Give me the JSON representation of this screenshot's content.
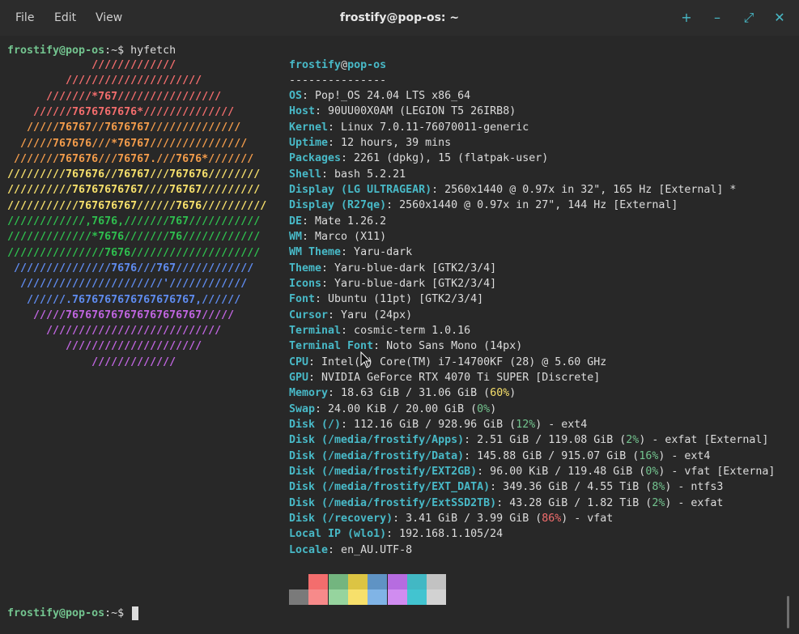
{
  "menu": {
    "file": "File",
    "edit": "Edit",
    "view": "View"
  },
  "window_title": "frostify@pop-os: ~",
  "window_buttons": {
    "new_tab": "+",
    "minimize": "–",
    "maximize": "⤢",
    "close": "✕"
  },
  "prompt": {
    "user": "frostify@pop-os",
    "sep": ":",
    "path": "~",
    "dollar": "$ ",
    "command": "hyfetch"
  },
  "art": [
    {
      "text": "             /////////////",
      "color": "#f36d6d"
    },
    {
      "text": "         /////////////////////",
      "color": "#f36d6d"
    },
    {
      "text": "      ///////*767////////////////",
      "color": "#f36d6d"
    },
    {
      "text": "    //////7676767676*//////////////",
      "color": "#f36d6d"
    },
    {
      "text": "   /////76767//7676767//////////////",
      "color": "#f39c4b"
    },
    {
      "text": "  /////767676///*76767///////////////",
      "color": "#f39c4b"
    },
    {
      "text": " ///////767676///76767.///7676*///////",
      "color": "#f39c4b"
    },
    {
      "text": "/////////767676//76767///767676////////",
      "color": "#f7e06b"
    },
    {
      "text": "//////////76767676767////76767/////////",
      "color": "#f7e06b"
    },
    {
      "text": "///////////767676767//////7676//////////",
      "color": "#f7e06b"
    },
    {
      "text": "////////////,7676,///////767///////////",
      "color": "#2fbf4f"
    },
    {
      "text": "/////////////*7676///////76////////////",
      "color": "#2fbf4f"
    },
    {
      "text": "///////////////7676////////////////////",
      "color": "#2fbf4f"
    },
    {
      "text": " ///////////////7676///767////////////",
      "color": "#5f8cf0"
    },
    {
      "text": "  //////////////////////'////////////",
      "color": "#5f8cf0"
    },
    {
      "text": "   //////.7676767676767676767,//////",
      "color": "#5f8cf0"
    },
    {
      "text": "    /////767676767676767676767/////",
      "color": "#c065e0"
    },
    {
      "text": "      ///////////////////////////",
      "color": "#c065e0"
    },
    {
      "text": "         /////////////////////",
      "color": "#c065e0"
    },
    {
      "text": "             /////////////",
      "color": "#c065e0"
    }
  ],
  "info_header": {
    "user": "frostify",
    "at": "@",
    "host": "pop-os",
    "rule": "---------------"
  },
  "info": [
    {
      "key": "OS",
      "val": ": Pop!_OS 24.04 LTS x86_64"
    },
    {
      "key": "Host",
      "val": ": 90UU00X0AM (LEGION T5 26IRB8)"
    },
    {
      "key": "Kernel",
      "val": ": Linux 7.0.11-76070011-generic"
    },
    {
      "key": "Uptime",
      "val": ": 12 hours, 39 mins"
    },
    {
      "key": "Packages",
      "val": ": 2261 (dpkg), 15 (flatpak-user)"
    },
    {
      "key": "Shell",
      "val": ": bash 5.2.21"
    },
    {
      "key": "Display (LG ULTRAGEAR)",
      "val": ": 2560x1440 @ 0.97x in 32\", 165 Hz [External] *"
    },
    {
      "key": "Display (R27qe)",
      "val": ": 2560x1440 @ 0.97x in 27\", 144 Hz [External]"
    },
    {
      "key": "DE",
      "val": ": Mate 1.26.2"
    },
    {
      "key": "WM",
      "val": ": Marco (X11)"
    },
    {
      "key": "WM Theme",
      "val": ": Yaru-dark"
    },
    {
      "key": "Theme",
      "val": ": Yaru-blue-dark [GTK2/3/4]"
    },
    {
      "key": "Icons",
      "val": ": Yaru-blue-dark [GTK2/3/4]"
    },
    {
      "key": "Font",
      "val": ": Ubuntu (11pt) [GTK2/3/4]"
    },
    {
      "key": "Cursor",
      "val": ": Yaru (24px)"
    },
    {
      "key": "Terminal",
      "val": ": cosmic-term 1.0.16"
    },
    {
      "key": "Terminal Font",
      "val": ": Noto Sans Mono (14px)"
    },
    {
      "key": "CPU",
      "val": ": Intel(R) Core(TM) i7-14700KF (28) @ 5.60 GHz"
    },
    {
      "key": "GPU",
      "val": ": NVIDIA GeForce RTX 4070 Ti SUPER [Discrete]"
    },
    {
      "key": "Memory",
      "val": ": 18.63 GiB / 31.06 GiB (",
      "pct": "60%",
      "pct_class": "pct-yellow",
      "after": ")"
    },
    {
      "key": "Swap",
      "val": ": 24.00 KiB / 20.00 GiB (",
      "pct": "0%",
      "pct_class": "pct-green",
      "after": ")"
    },
    {
      "key": "Disk (/)",
      "val": ": 112.16 GiB / 928.96 GiB (",
      "pct": "12%",
      "pct_class": "pct-green",
      "after": ") - ext4"
    },
    {
      "key": "Disk (/media/frostify/Apps)",
      "val": ": 2.51 GiB / 119.08 GiB (",
      "pct": "2%",
      "pct_class": "pct-green",
      "after": ") - exfat [External]"
    },
    {
      "key": "Disk (/media/frostify/Data)",
      "val": ": 145.88 GiB / 915.07 GiB (",
      "pct": "16%",
      "pct_class": "pct-green",
      "after": ") - ext4"
    },
    {
      "key": "Disk (/media/frostify/EXT2GB)",
      "val": ": 96.00 KiB / 119.48 GiB (",
      "pct": "0%",
      "pct_class": "pct-green",
      "after": ") - vfat [Externa]"
    },
    {
      "key": "Disk (/media/frostify/EXT_DATA)",
      "val": ": 349.36 GiB / 4.55 TiB (",
      "pct": "8%",
      "pct_class": "pct-green",
      "after": ") - ntfs3"
    },
    {
      "key": "Disk (/media/frostify/ExtSSD2TB)",
      "val": ": 43.28 GiB / 1.82 TiB (",
      "pct": "2%",
      "pct_class": "pct-green",
      "after": ") - exfat"
    },
    {
      "key": "Disk (/recovery)",
      "val": ": 3.41 GiB / 3.99 GiB (",
      "pct": "86%",
      "pct_class": "pct-red",
      "after": ") - vfat"
    },
    {
      "key": "Local IP (wlo1)",
      "val": ": 192.168.1.105/24"
    },
    {
      "key": "Locale",
      "val": ": en_AU.UTF-8"
    }
  ],
  "palette_top": [
    "#282828",
    "#f36d6d",
    "#73b57f",
    "#dcc443",
    "#5f93c4",
    "#b66ce0",
    "#42b8c4",
    "#c2c2c2"
  ],
  "palette_bottom": [
    "#7a7a7a",
    "#f78a8a",
    "#96d49e",
    "#f7e06b",
    "#80b4e6",
    "#d08cf0",
    "#42c4d0",
    "#d2d2d2"
  ]
}
